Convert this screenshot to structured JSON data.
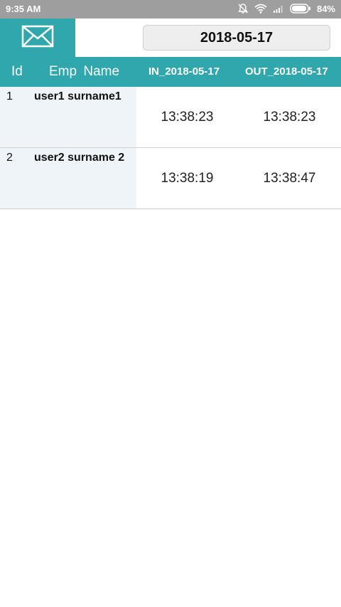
{
  "status_bar": {
    "time": "9:35 AM",
    "battery": "84%",
    "icons": [
      "alarm-off-icon",
      "wifi-icon",
      "signal-icon",
      "battery-icon"
    ]
  },
  "toolbar": {
    "mail_icon": "mail-icon",
    "date": "2018-05-17"
  },
  "table": {
    "headers": {
      "id": "Id",
      "name": "Emp Name",
      "in": "IN_2018-05-17",
      "out": "OUT_2018-05-17"
    },
    "rows": [
      {
        "id": "1",
        "name": "user1 surname1",
        "in": "13:38:23",
        "out": "13:38:23"
      },
      {
        "id": "2",
        "name": "user2 surname 2",
        "in": "13:38:19",
        "out": "13:38:47"
      }
    ]
  },
  "colors": {
    "accent": "#2fa7ac",
    "status_bar": "#9e9e9e",
    "row_left_bg": "#eef4f7"
  }
}
